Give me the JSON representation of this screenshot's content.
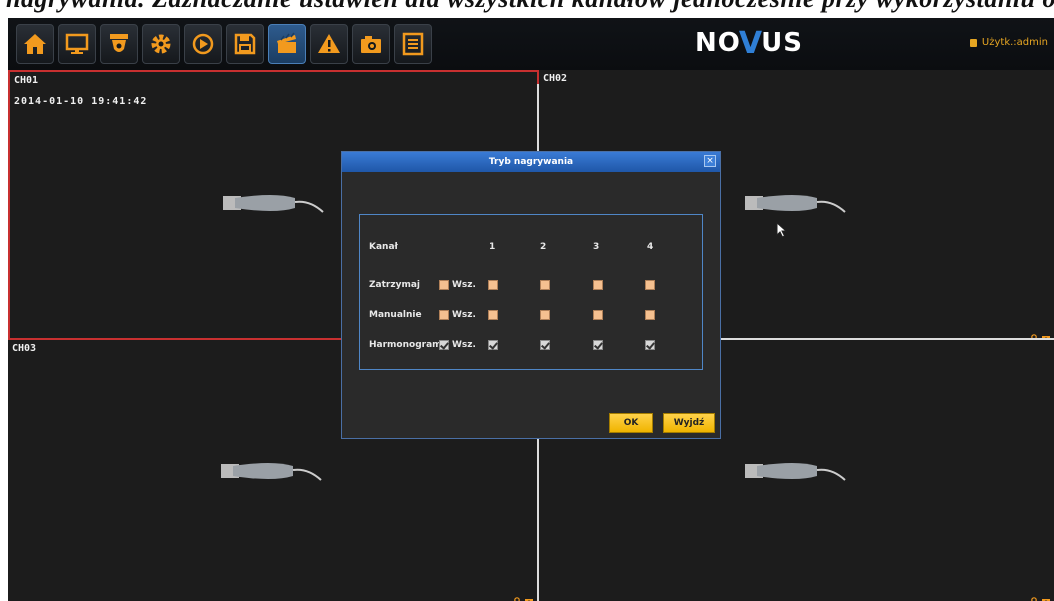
{
  "banner": {
    "text": "nagrywania. Zaznaczanie ustawień dla wszystkich kanałów jednocześnie przy wykorzystaniu opcji Wsz. dla danego trybu nagrywania"
  },
  "toolbar": {
    "items": [
      {
        "name": "home-icon",
        "active": false
      },
      {
        "name": "monitor-icon",
        "active": false
      },
      {
        "name": "ptz-camera-icon",
        "active": false
      },
      {
        "name": "settings-gear-icon",
        "active": false
      },
      {
        "name": "playback-icon",
        "active": false
      },
      {
        "name": "save-floppy-icon",
        "active": false
      },
      {
        "name": "record-clapper-icon",
        "active": true
      },
      {
        "name": "alarm-warning-icon",
        "active": false
      },
      {
        "name": "snapshot-camera-icon",
        "active": false
      },
      {
        "name": "log-list-icon",
        "active": false
      }
    ],
    "accent": "#f29a1e"
  },
  "logo": {
    "part1": "NO",
    "part2": "V",
    "part3": "US"
  },
  "user": {
    "label": "Użytk.:admin"
  },
  "tiles": [
    {
      "label": "CH01",
      "time": "2014-01-10 19:41:42",
      "selected": true
    },
    {
      "label": "CH02",
      "time": "",
      "selected": false
    },
    {
      "label": "CH03",
      "time": "",
      "selected": false
    },
    {
      "label": "",
      "time": "",
      "selected": false
    }
  ],
  "dialog": {
    "title": "Tryb nagrywania",
    "close": "×",
    "channel_header": "Kanał",
    "channels": [
      "1",
      "2",
      "3",
      "4"
    ],
    "all_label": "Wsz.",
    "rows": [
      {
        "label": "Zatrzymaj",
        "all_checked": false,
        "checked": [
          false,
          false,
          false,
          false
        ]
      },
      {
        "label": "Manualnie",
        "all_checked": false,
        "checked": [
          false,
          false,
          false,
          false
        ]
      },
      {
        "label": "Harmonogram",
        "all_checked": true,
        "checked": [
          true,
          true,
          true,
          true
        ]
      }
    ],
    "ok": "OK",
    "exit": "Wyjdź"
  },
  "colors": {
    "selected_border": "#c83030",
    "dialog_title": "#2d6cc4",
    "button": "#f5c000"
  }
}
